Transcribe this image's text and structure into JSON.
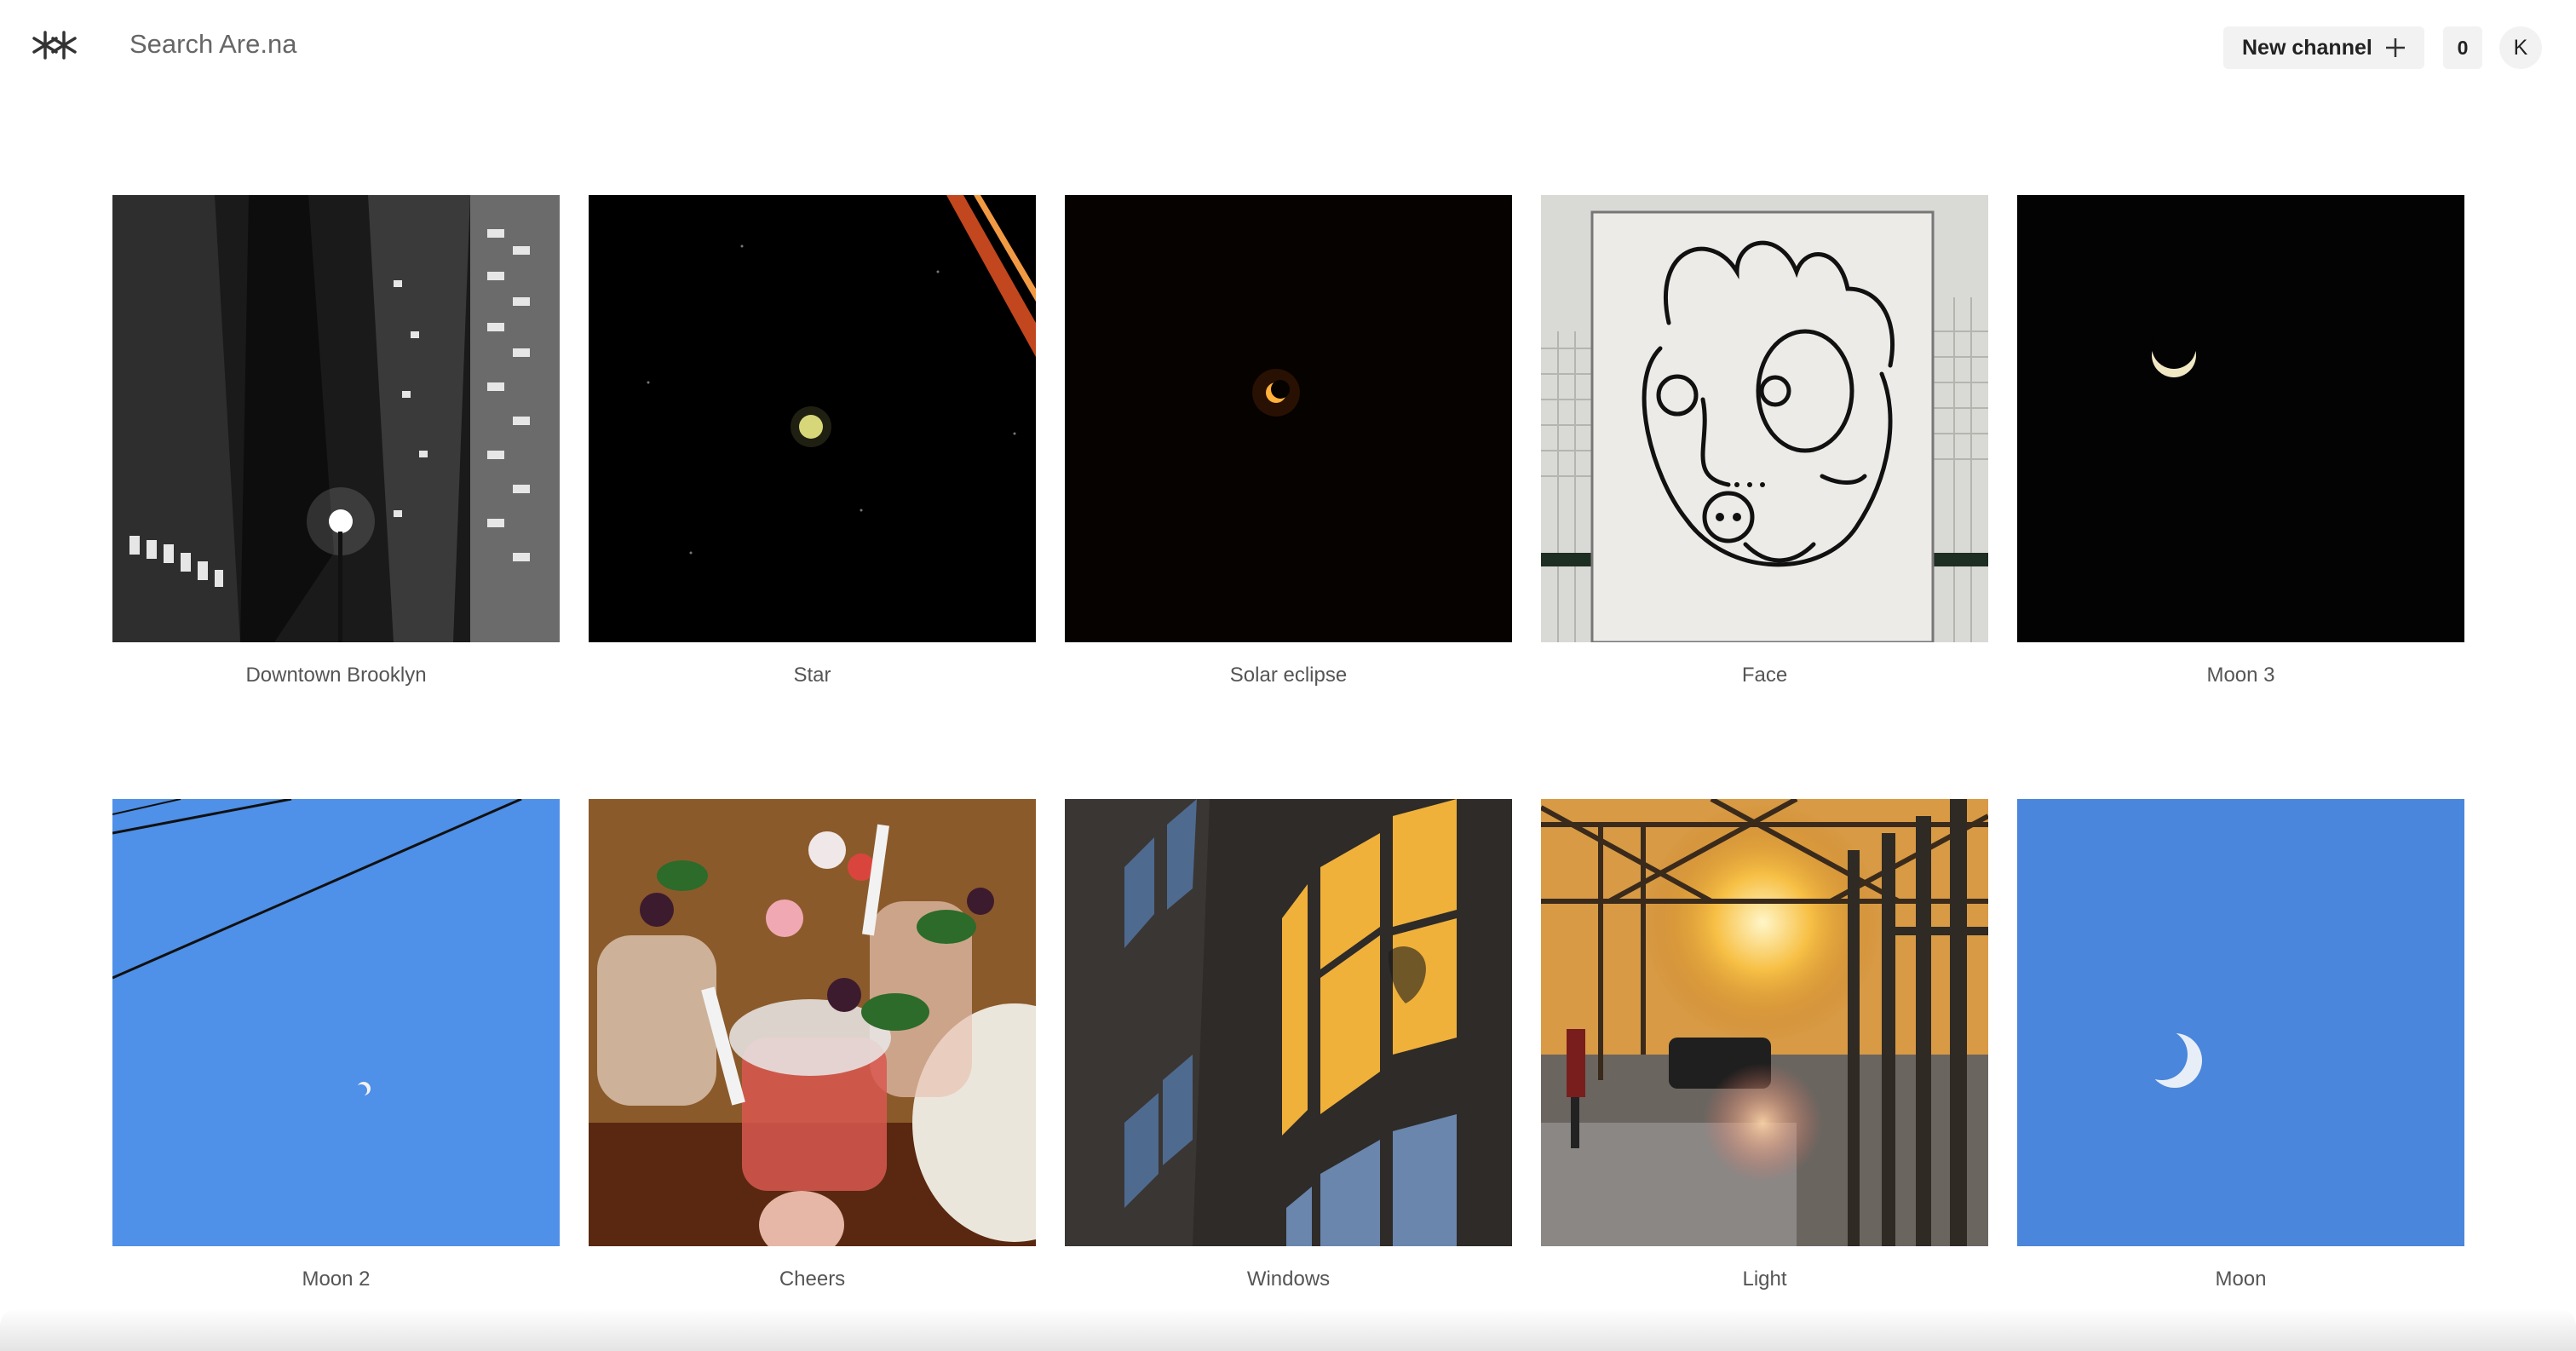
{
  "header": {
    "search_placeholder": "Search Are.na",
    "new_channel_label": "New channel",
    "notification_count": "0",
    "avatar_initial": "K"
  },
  "blocks": [
    {
      "title": "Downtown Brooklyn"
    },
    {
      "title": "Star"
    },
    {
      "title": "Solar eclipse"
    },
    {
      "title": "Face"
    },
    {
      "title": "Moon 3"
    },
    {
      "title": "Moon 2"
    },
    {
      "title": "Cheers"
    },
    {
      "title": "Windows"
    },
    {
      "title": "Light"
    },
    {
      "title": "Moon"
    }
  ],
  "icons": {
    "logo": "arena-logo-icon",
    "new_channel": "plus-icon"
  }
}
